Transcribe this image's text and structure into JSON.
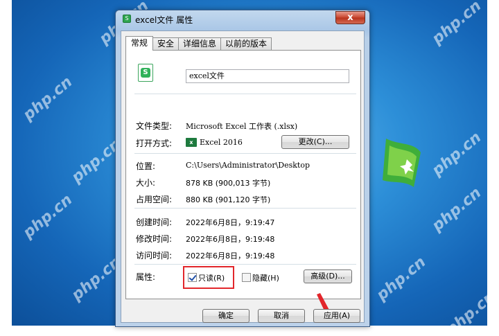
{
  "window": {
    "title": "excel文件 属性",
    "close_glyph": "x"
  },
  "tabs": [
    {
      "label": "常规",
      "active": true
    },
    {
      "label": "安全",
      "active": false
    },
    {
      "label": "详细信息",
      "active": false
    },
    {
      "label": "以前的版本",
      "active": false
    }
  ],
  "file": {
    "icon_letter": "S",
    "name": "excel文件"
  },
  "props": {
    "type_label": "文件类型:",
    "type_value": "Microsoft Excel 工作表 (.xlsx)",
    "open_label": "打开方式:",
    "open_icon": "x",
    "open_value": "Excel 2016",
    "change_button": "更改(C)...",
    "location_label": "位置:",
    "location_value": "C:\\Users\\Administrator\\Desktop",
    "size_label": "大小:",
    "size_value": "878 KB (900,013 字节)",
    "disk_label": "占用空间:",
    "disk_value": "880 KB (901,120 字节)",
    "created_label": "创建时间:",
    "created_value": "2022年6月8日，9:19:47",
    "modified_label": "修改时间:",
    "modified_value": "2022年6月8日，9:19:48",
    "accessed_label": "访问时间:",
    "accessed_value": "2022年6月8日，9:19:48"
  },
  "attributes": {
    "label": "属性:",
    "readonly_label": "只读(R)",
    "readonly_checked": true,
    "hidden_label": "隐藏(H)",
    "hidden_checked": false,
    "advanced_button": "高级(D)..."
  },
  "buttons": {
    "ok": "确定",
    "cancel": "取消",
    "apply": "应用(A)"
  },
  "watermark": "php.cn",
  "colors": {
    "highlight": "#e2262b",
    "excel_green": "#30b25a"
  }
}
